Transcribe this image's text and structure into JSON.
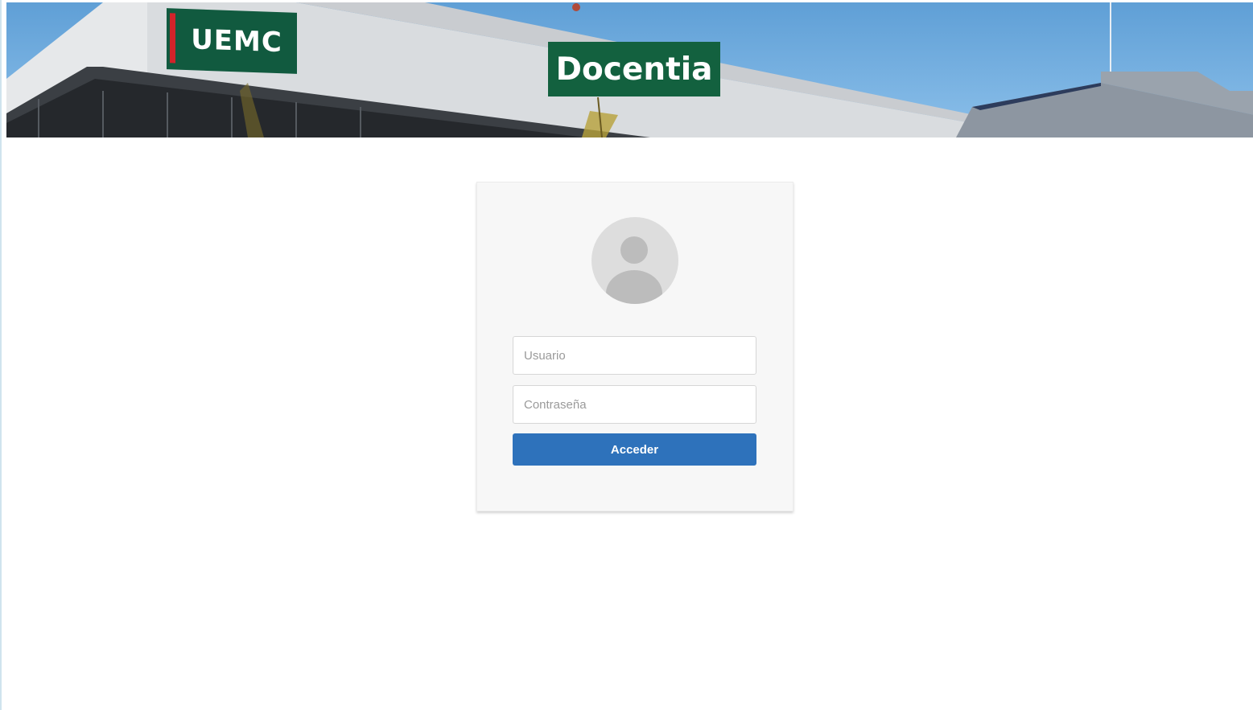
{
  "banner": {
    "logo_text": "UEMC",
    "site_title": "Docentia"
  },
  "login": {
    "username_placeholder": "Usuario",
    "password_placeholder": "Contraseña",
    "submit_label": "Acceder"
  },
  "colors": {
    "brand_green": "#13613f",
    "brand_red": "#d2232a",
    "button_blue": "#2e72bb"
  }
}
